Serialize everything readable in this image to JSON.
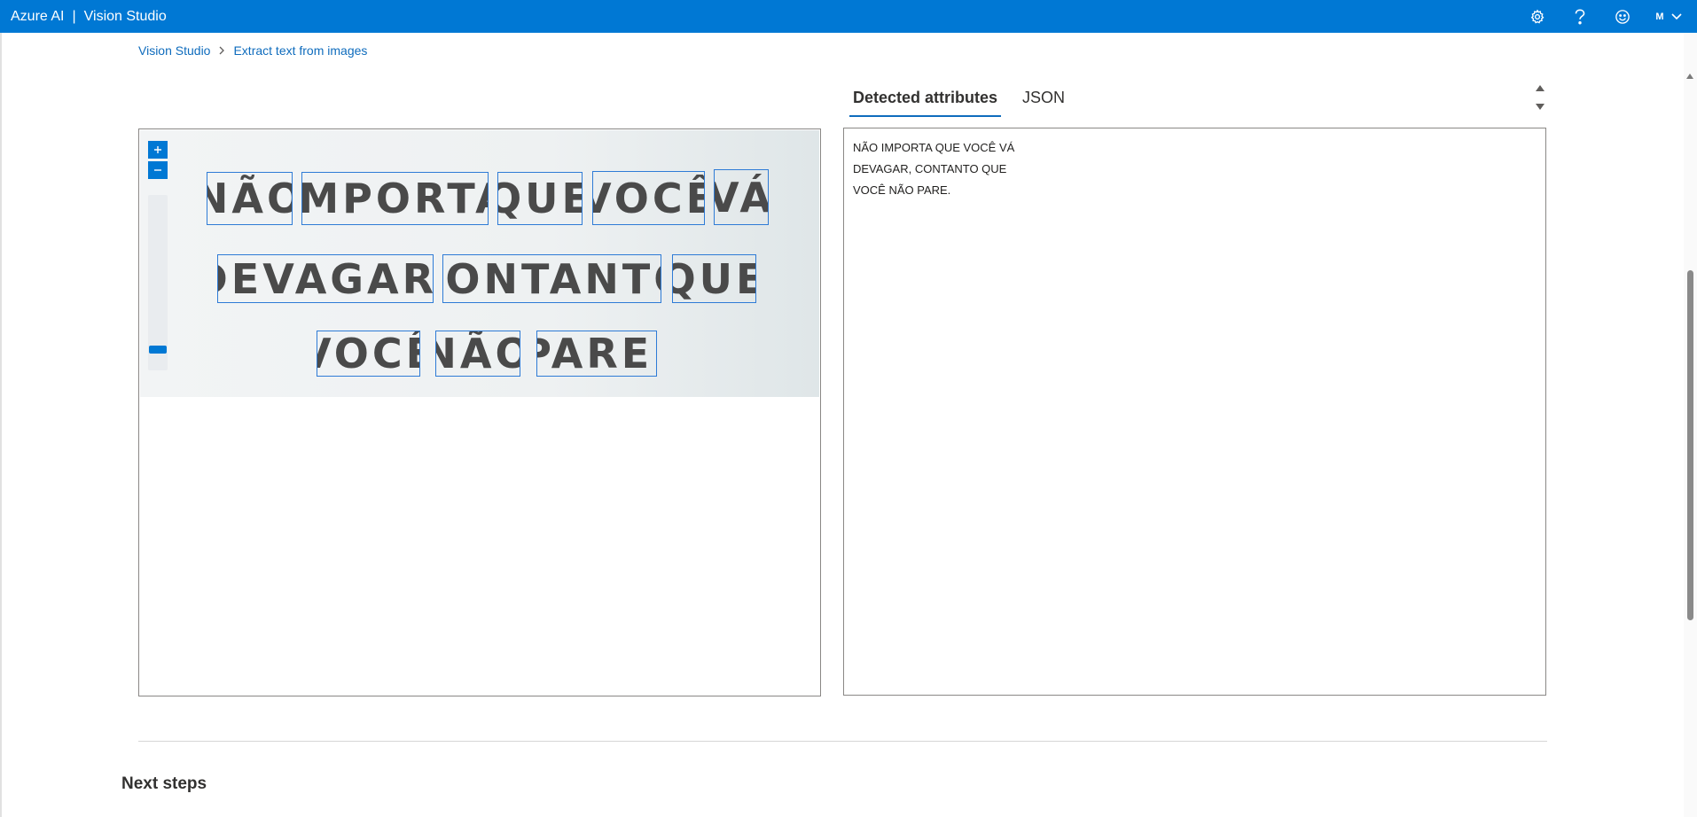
{
  "app": {
    "brand": "Azure AI",
    "separator": "|",
    "product": "Vision Studio"
  },
  "header_icons": {
    "settings": "gear-icon",
    "help": "question-icon",
    "feedback": "smiley-icon",
    "avatar_initial": "M"
  },
  "breadcrumb": {
    "root": "Vision Studio",
    "current": "Extract text from images"
  },
  "image": {
    "words": [
      "NÃO",
      "IMPORTA",
      "QUE",
      "VOCÊ",
      "VÁ",
      "DEVAGAR,",
      "CONTANTO",
      "QUE",
      "VOCÊ",
      "NÃO",
      "PARE."
    ],
    "zoom": {
      "in": "+",
      "out": "−"
    }
  },
  "tabs": [
    "Detected attributes",
    "JSON"
  ],
  "results": {
    "lines": [
      "NÃO IMPORTA QUE VOCÊ VÁ",
      "DEVAGAR, CONTANTO QUE",
      "VOCÊ NÃO PARE."
    ]
  },
  "next_steps": {
    "heading": "Next steps"
  },
  "colors": {
    "accent": "#0078d4",
    "link": "#0f6cbd",
    "box": "#2e7bd6"
  }
}
